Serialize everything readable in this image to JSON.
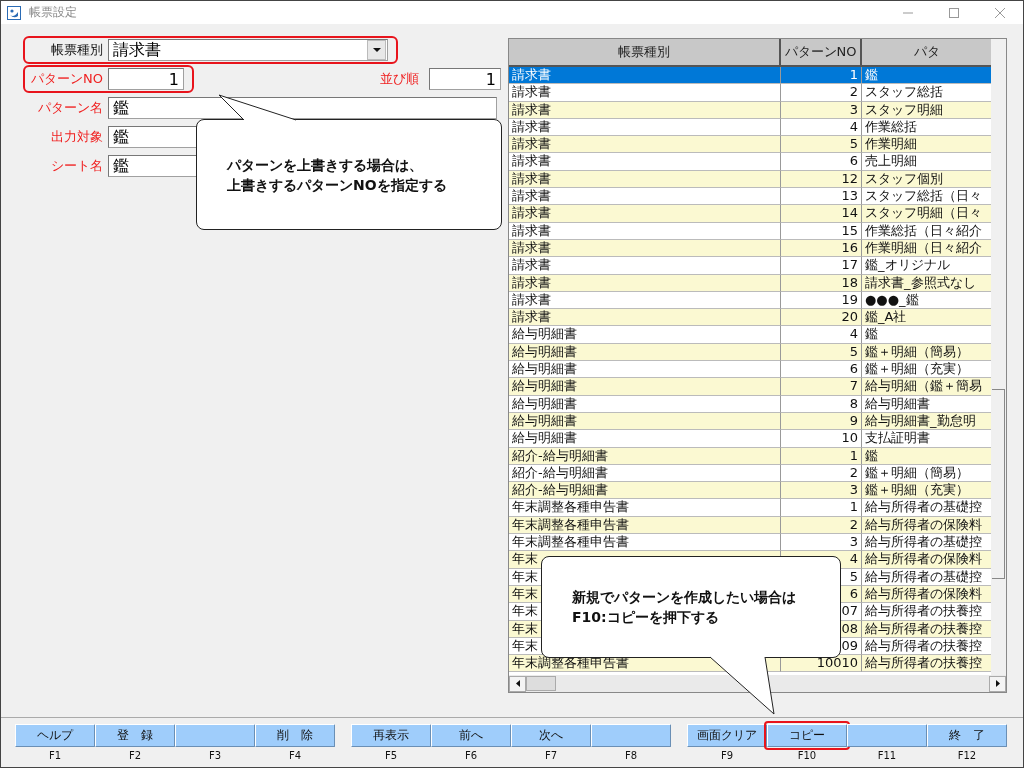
{
  "window": {
    "title": "帳票設定"
  },
  "form": {
    "report_type": {
      "label": "帳票種別",
      "value": "請求書",
      "required": false,
      "highlighted": true
    },
    "pattern_no": {
      "label": "パターンNO",
      "value": "1",
      "required": true,
      "highlighted": true
    },
    "sort_order": {
      "label": "並び順",
      "value": "1",
      "required": true
    },
    "pattern_name": {
      "label": "パターン名",
      "value": "鑑",
      "required": true
    },
    "output_target": {
      "label": "出力対象",
      "value": "鑑",
      "required": true
    },
    "sheet_name": {
      "label": "シート名",
      "value": "鑑",
      "required": true
    }
  },
  "table": {
    "columns": [
      "帳票種別",
      "パターンNO",
      "パタ"
    ],
    "rows": [
      {
        "cells": [
          "請求書",
          "1",
          "鑑"
        ],
        "selected": true
      },
      {
        "cells": [
          "請求書",
          "2",
          "スタッフ総括"
        ],
        "selected": false
      },
      {
        "cells": [
          "請求書",
          "3",
          "スタッフ明細"
        ],
        "selected": false
      },
      {
        "cells": [
          "請求書",
          "4",
          "作業総括"
        ],
        "selected": false
      },
      {
        "cells": [
          "請求書",
          "5",
          "作業明細"
        ],
        "selected": false
      },
      {
        "cells": [
          "請求書",
          "6",
          "売上明細"
        ],
        "selected": false
      },
      {
        "cells": [
          "請求書",
          "12",
          "スタッフ個別"
        ],
        "selected": false
      },
      {
        "cells": [
          "請求書",
          "13",
          "スタッフ総括（日々"
        ],
        "selected": false
      },
      {
        "cells": [
          "請求書",
          "14",
          "スタッフ明細（日々"
        ],
        "selected": false
      },
      {
        "cells": [
          "請求書",
          "15",
          "作業総括（日々紹介"
        ],
        "selected": false
      },
      {
        "cells": [
          "請求書",
          "16",
          "作業明細（日々紹介"
        ],
        "selected": false
      },
      {
        "cells": [
          "請求書",
          "17",
          "鑑_オリジナル"
        ],
        "selected": false
      },
      {
        "cells": [
          "請求書",
          "18",
          "請求書_参照式なし"
        ],
        "selected": false
      },
      {
        "cells": [
          "請求書",
          "19",
          "●●●_鑑"
        ],
        "selected": false
      },
      {
        "cells": [
          "請求書",
          "20",
          "鑑_A社"
        ],
        "selected": false
      },
      {
        "cells": [
          "給与明細書",
          "4",
          "鑑"
        ],
        "selected": false
      },
      {
        "cells": [
          "給与明細書",
          "5",
          "鑑＋明細（簡易）"
        ],
        "selected": false
      },
      {
        "cells": [
          "給与明細書",
          "6",
          "鑑＋明細（充実）"
        ],
        "selected": false
      },
      {
        "cells": [
          "給与明細書",
          "7",
          "給与明細（鑑＋簡易"
        ],
        "selected": false
      },
      {
        "cells": [
          "給与明細書",
          "8",
          "給与明細書"
        ],
        "selected": false
      },
      {
        "cells": [
          "給与明細書",
          "9",
          "給与明細書_勤怠明"
        ],
        "selected": false
      },
      {
        "cells": [
          "給与明細書",
          "10",
          "支払証明書"
        ],
        "selected": false
      },
      {
        "cells": [
          "紹介-給与明細書",
          "1",
          "鑑"
        ],
        "selected": false
      },
      {
        "cells": [
          "紹介-給与明細書",
          "2",
          "鑑＋明細（簡易）"
        ],
        "selected": false
      },
      {
        "cells": [
          "紹介-給与明細書",
          "3",
          "鑑＋明細（充実）"
        ],
        "selected": false
      },
      {
        "cells": [
          "年末調整各種申告書",
          "1",
          "給与所得者の基礎控"
        ],
        "selected": false
      },
      {
        "cells": [
          "年末調整各種申告書",
          "2",
          "給与所得者の保険料"
        ],
        "selected": false
      },
      {
        "cells": [
          "年末調整各種申告書",
          "3",
          "給与所得者の基礎控"
        ],
        "selected": false
      },
      {
        "cells": [
          "年末",
          "4",
          "給与所得者の保険料"
        ],
        "selected": false
      },
      {
        "cells": [
          "年末",
          "5",
          "給与所得者の基礎控"
        ],
        "selected": false
      },
      {
        "cells": [
          "年末",
          "6",
          "給与所得者の保険料"
        ],
        "selected": false
      },
      {
        "cells": [
          "年末",
          "07",
          "給与所得者の扶養控"
        ],
        "selected": false
      },
      {
        "cells": [
          "年末",
          "08",
          "給与所得者の扶養控"
        ],
        "selected": false
      },
      {
        "cells": [
          "年末",
          "09",
          "給与所得者の扶養控"
        ],
        "selected": false
      },
      {
        "cells": [
          "年末調整各種申告書",
          "10010",
          "給与所得者の扶養控"
        ],
        "selected": false
      }
    ]
  },
  "callouts": [
    {
      "lines": [
        "パターンを上書きする場合は、",
        "上書きするパターンNOを指定する"
      ]
    },
    {
      "lines": [
        "新規でパターンを作成したい場合は",
        "F10:コピーを押下する"
      ]
    }
  ],
  "function_keys": [
    {
      "key": "F1",
      "label": "ヘルプ",
      "highlighted": false
    },
    {
      "key": "F2",
      "label": "登　録",
      "highlighted": false
    },
    {
      "key": "F3",
      "highlighted": false
    },
    {
      "key": "F4",
      "label": "削　除",
      "highlighted": false
    },
    {
      "key": "F5",
      "label": "再表示",
      "highlighted": false
    },
    {
      "key": "F6",
      "label": "前へ",
      "highlighted": false
    },
    {
      "key": "F7",
      "label": "次へ",
      "highlighted": false
    },
    {
      "key": "F8",
      "highlighted": false
    },
    {
      "key": "F9",
      "label": "画面クリア",
      "highlighted": false
    },
    {
      "key": "F10",
      "label": "コピー",
      "highlighted": true
    },
    {
      "key": "F11",
      "highlighted": false
    },
    {
      "key": "F12",
      "label": "終　了",
      "highlighted": false
    }
  ]
}
